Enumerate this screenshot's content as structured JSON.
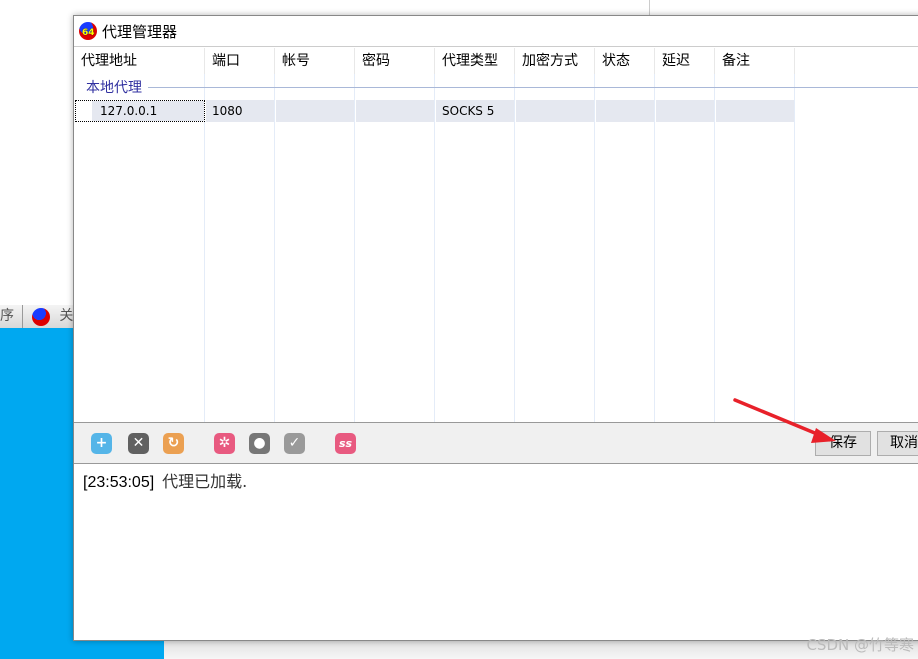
{
  "window": {
    "title": "代理管理器",
    "logo_text": "64"
  },
  "background_strip": {
    "left_text": "序",
    "item_label": "关于"
  },
  "table": {
    "columns": [
      "代理地址",
      "端口",
      "帐号",
      "密码",
      "代理类型",
      "加密方式",
      "状态",
      "延迟",
      "备注"
    ],
    "group": "本地代理",
    "rows": [
      {
        "address": "127.0.0.1",
        "port": "1080",
        "account": "",
        "password": "",
        "type": "SOCKS 5",
        "encryption": "",
        "status": "",
        "latency": "",
        "note": ""
      }
    ]
  },
  "toolbar": {
    "icons": [
      "add-icon",
      "delete-icon",
      "refresh-icon",
      "settings-icon",
      "bulb-icon",
      "check-icon",
      "ss-icon"
    ],
    "ss_label": "ss",
    "save": "保存",
    "cancel": "取消"
  },
  "log": {
    "time": "[23:53:05]",
    "message": "代理已加载."
  },
  "watermark": "CSDN @竹等寒",
  "colors": {
    "desktop": "#00a8f0",
    "annotation_arrow": "#e8212a"
  }
}
